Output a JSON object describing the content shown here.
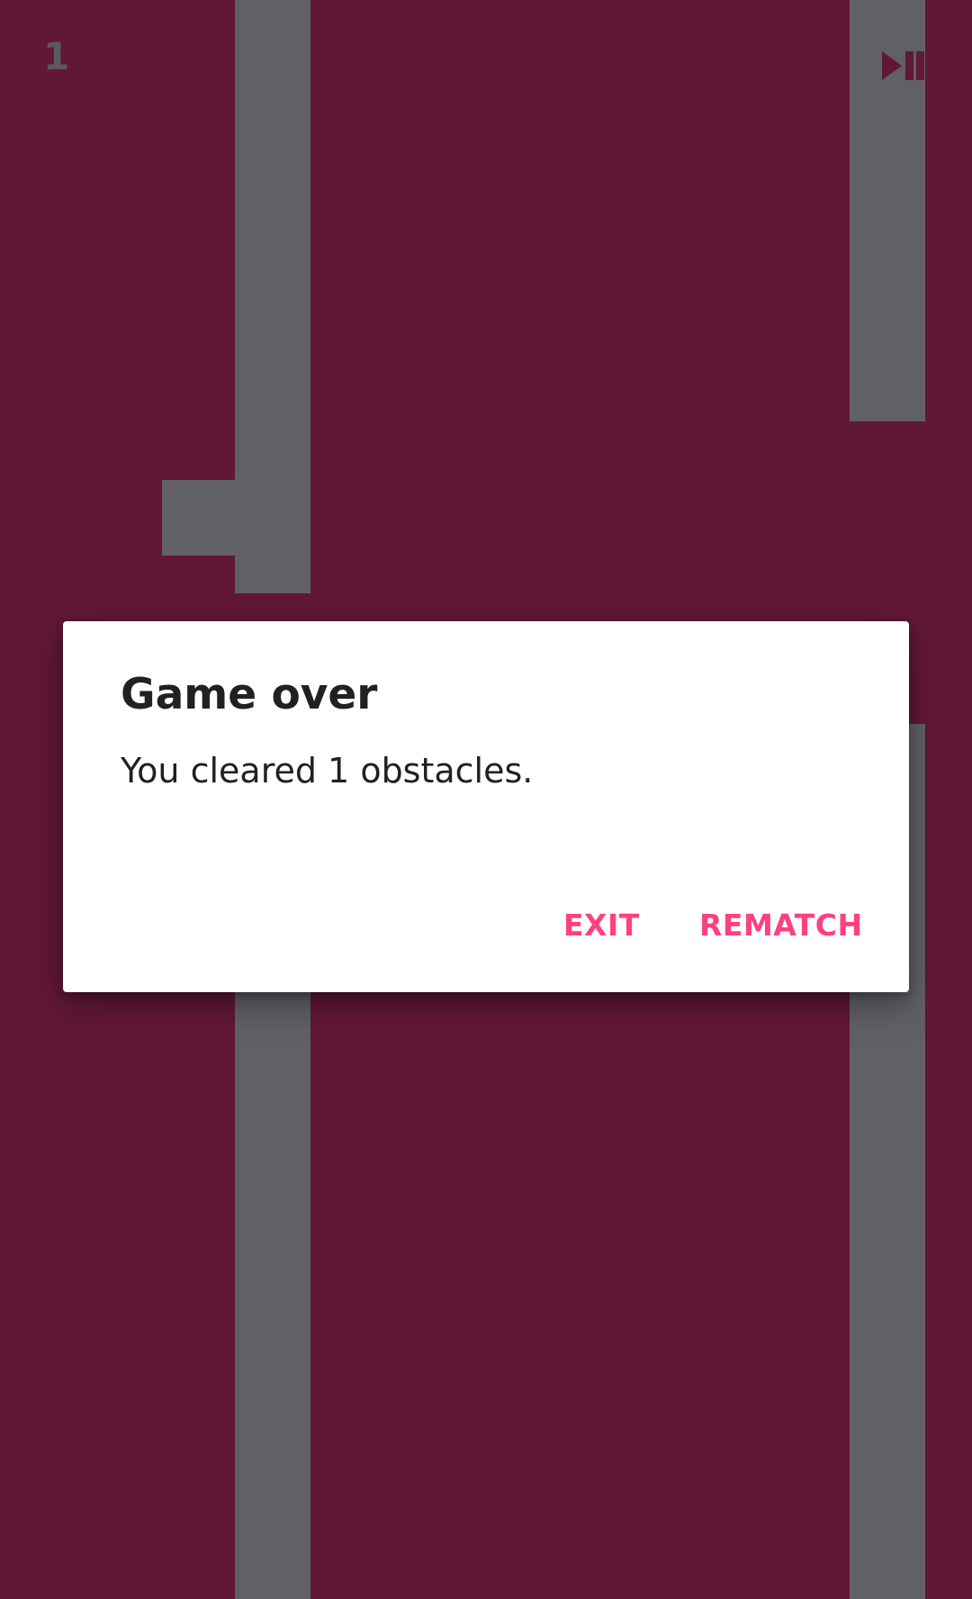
{
  "game": {
    "score": "1",
    "colors": {
      "background": "#611835",
      "obstacle": "#616065",
      "hud": "#5a5a5e"
    },
    "controls": {
      "play_pause_icon": "play-pause-icon"
    }
  },
  "dialog": {
    "title": "Game over",
    "message": "You cleared 1 obstacles.",
    "exit_label": "EXIT",
    "rematch_label": "REMATCH",
    "accent_color": "#ff4081"
  }
}
